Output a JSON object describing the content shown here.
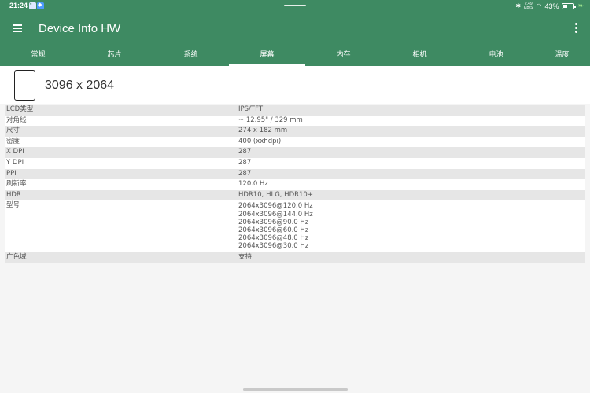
{
  "status_bar": {
    "time": "21:24",
    "network_top": "2.49",
    "network_bottom": "KB/S",
    "battery": "43%",
    "battery_level": 0.43
  },
  "app_bar": {
    "title": "Device Info HW"
  },
  "tabs": [
    {
      "label": "常规"
    },
    {
      "label": "芯片"
    },
    {
      "label": "系统"
    },
    {
      "label": "屏幕",
      "active": true
    },
    {
      "label": "内存"
    },
    {
      "label": "相机"
    },
    {
      "label": "电池"
    },
    {
      "label": "温度"
    }
  ],
  "header": {
    "resolution": "3096 x 2064"
  },
  "rows": [
    {
      "label": "LCD类型",
      "value": "IPS/TFT"
    },
    {
      "label": "对角线",
      "value": "~ 12.95\" / 329 mm"
    },
    {
      "label": "尺寸",
      "value": "274 x 182 mm"
    },
    {
      "label": "密度",
      "value": "400 (xxhdpi)"
    },
    {
      "label": "X DPI",
      "value": "287"
    },
    {
      "label": "Y DPI",
      "value": "287"
    },
    {
      "label": "PPI",
      "value": "287"
    },
    {
      "label": "刷新率",
      "value": "120.0 Hz"
    },
    {
      "label": "HDR",
      "value": "HDR10, HLG, HDR10+"
    },
    {
      "label": "型号",
      "values": [
        "2064x3096@120.0 Hz",
        "2064x3096@144.0 Hz",
        "2064x3096@90.0 Hz",
        "2064x3096@60.0 Hz",
        "2064x3096@48.0 Hz",
        "2064x3096@30.0 Hz"
      ]
    },
    {
      "label": "广色域",
      "value": "支持"
    }
  ],
  "colors": {
    "primary": "#3e8a62",
    "row_alt": "#e6e6e6",
    "background": "#f5f5f5"
  }
}
